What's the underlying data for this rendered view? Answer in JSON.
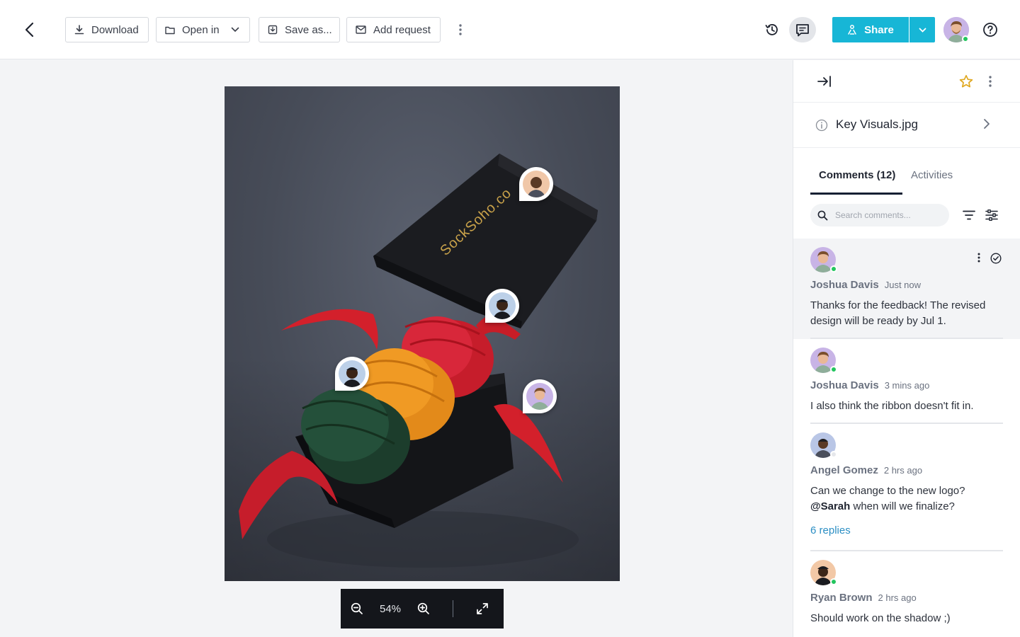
{
  "toolbar": {
    "download_label": "Download",
    "open_in_label": "Open in",
    "save_as_label": "Save as...",
    "add_request_label": "Add request",
    "share_label": "Share"
  },
  "viewer": {
    "zoom_level": "54%",
    "image_brand_text": "SockSoho.co"
  },
  "panel": {
    "file_name": "Key Visuals.jpg",
    "tabs": [
      {
        "label": "Comments (12)",
        "active": true
      },
      {
        "label": "Activities",
        "active": false
      }
    ],
    "search_placeholder": "Search comments..."
  },
  "comments": [
    {
      "author": "Joshua Davis",
      "time": "Just now",
      "text": "Thanks for the feedback! The revised design will be ready by Jul 1.",
      "online": true
    },
    {
      "author": "Joshua Davis",
      "time": "3 mins ago",
      "text": "I also think the ribbon doesn't fit in.",
      "online": true
    },
    {
      "author": "Angel Gomez",
      "time": "2 hrs ago",
      "text_line1": "Can we change to the new logo?",
      "mention": "@Sarah",
      "text_line2": " when will we finalize?",
      "replies": "6 replies",
      "online": false
    },
    {
      "author": "Ryan Brown",
      "time": "2 hrs ago",
      "text": "Should work on the shadow ;)",
      "online": true
    }
  ],
  "colors": {
    "accent": "#17b6d6",
    "link": "#2c8fc4",
    "star": "#e0a820",
    "online": "#22c55e"
  }
}
